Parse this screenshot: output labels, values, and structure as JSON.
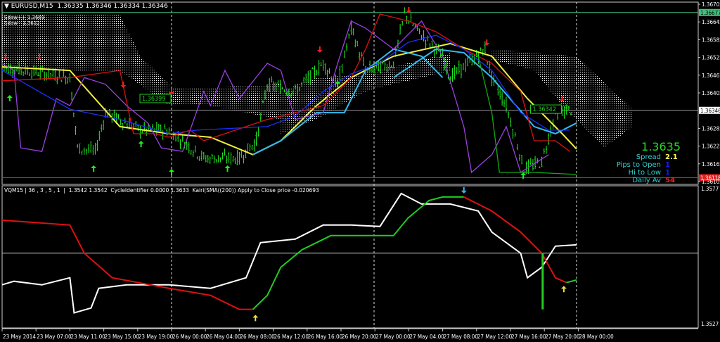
{
  "header": {
    "symbol": "EURUSD,M15",
    "ohlc": "1.36335 1.36346 1.36334 1.36346"
  },
  "indicator_header": "VQM15 | 36 , 3 , 5 , 1  |  1.3542 1.3542  CycleIdentifier 0.0000 1.3633  Kairi(SMA((200)) Apply to Close price -0.020693",
  "sdaw_labels": [
    "Sdaw++ 1.3669",
    "Sdaw-- 1.3612"
  ],
  "info_panel": {
    "price": "1.3635",
    "rows": [
      {
        "label": "Spread",
        "value": "2.1",
        "color": "#ffff55"
      },
      {
        "label": "Pips to Open",
        "value": "1",
        "color": "#1a1aff"
      },
      {
        "label": "Hi to Low",
        "value": "1",
        "color": "#1a1aff"
      },
      {
        "label": "Daily Av",
        "value": "54",
        "color": "#ee2222"
      }
    ]
  },
  "chart_data": {
    "type": "line",
    "title": "EURUSD,M15",
    "x_unit": "hours from first bar",
    "time_labels": [
      "23 May 2014",
      "23 May 07:00",
      "23 May 11:00",
      "23 May 15:00",
      "23 May 19:00",
      "26 May 00:00",
      "26 May 04:00",
      "26 May 08:00",
      "26 May 12:00",
      "26 May 16:00",
      "26 May 20:00",
      "27 May 00:00",
      "27 May 04:00",
      "27 May 08:00",
      "27 May 12:00",
      "27 May 16:00",
      "27 May 20:00",
      "28 May 00:00"
    ],
    "price_axis": {
      "range": [
        1.36105,
        1.36705
      ],
      "ticks": [
        "1.36705",
        "1.36645",
        "1.36585",
        "1.36525",
        "1.36465",
        "1.36405",
        "1.36285",
        "1.36225",
        "1.36165",
        "1.36105"
      ]
    },
    "hlines": [
      {
        "price": 1.36677,
        "label": "1.36677",
        "color": "#3ec37a"
      },
      {
        "price": 1.36346,
        "label": "1.36346",
        "color": "#9a9a9a"
      },
      {
        "price": 1.36118,
        "label": "1.36118",
        "color": "#e02020"
      }
    ],
    "price_labels": [
      {
        "x": 20.0,
        "price": 1.36386,
        "label": "1.36399"
      },
      {
        "x": 66.1,
        "price": 1.3635,
        "label": "1.36342"
      }
    ],
    "series": [
      {
        "name": "price",
        "color": "#22ee22",
        "points": [
          [
            0,
            1.36493
          ],
          [
            8.0,
            1.36457
          ],
          [
            8.9,
            1.36219
          ],
          [
            11.0,
            1.36207
          ],
          [
            12.2,
            1.36338
          ],
          [
            16.3,
            1.36279
          ],
          [
            19.7,
            1.36279
          ],
          [
            21.3,
            1.36243
          ],
          [
            23.8,
            1.36184
          ],
          [
            28.0,
            1.36184
          ],
          [
            30.0,
            1.36243
          ],
          [
            31.3,
            1.36434
          ],
          [
            34.6,
            1.3641
          ],
          [
            37.9,
            1.36505
          ],
          [
            39.6,
            1.36434
          ],
          [
            41.2,
            1.36624
          ],
          [
            42.9,
            1.36481
          ],
          [
            46.2,
            1.36505
          ],
          [
            47.5,
            1.36672
          ],
          [
            49.5,
            1.366
          ],
          [
            52.0,
            1.36529
          ],
          [
            52.9,
            1.36457
          ],
          [
            57.0,
            1.36553
          ],
          [
            57.8,
            1.36457
          ],
          [
            59.5,
            1.36362
          ],
          [
            61.6,
            1.36148
          ],
          [
            63.7,
            1.36172
          ],
          [
            65.3,
            1.36338
          ],
          [
            67.4,
            1.3635
          ]
        ]
      },
      {
        "name": "yellow-ma",
        "color": "#f0f040",
        "points": [
          [
            0,
            1.36493
          ],
          [
            8.0,
            1.36481
          ],
          [
            13.9,
            1.36291
          ],
          [
            19.7,
            1.36267
          ],
          [
            24.6,
            1.36255
          ],
          [
            29.6,
            1.36196
          ],
          [
            32.9,
            1.36243
          ],
          [
            37.1,
            1.36362
          ],
          [
            41.2,
            1.36457
          ],
          [
            46.2,
            1.36529
          ],
          [
            52.9,
            1.36572
          ],
          [
            57.8,
            1.36529
          ],
          [
            62.0,
            1.36386
          ],
          [
            66.1,
            1.36267
          ],
          [
            67.8,
            1.36215
          ]
        ]
      },
      {
        "name": "cyan-cycle-1",
        "color": "#33bbee",
        "points": [
          [
            29.6,
            1.36196
          ],
          [
            32.9,
            1.36243
          ],
          [
            37.1,
            1.36338
          ],
          [
            40.4,
            1.36338
          ],
          [
            42.9,
            1.36481
          ],
          [
            46.2,
            1.36553
          ],
          [
            49.5,
            1.36529
          ],
          [
            52.0,
            1.36457
          ]
        ]
      },
      {
        "name": "cyan-cycle-2",
        "color": "#33bbee",
        "points": [
          [
            46.2,
            1.36457
          ],
          [
            51.2,
            1.36553
          ],
          [
            54.5,
            1.36541
          ],
          [
            57.8,
            1.36457
          ],
          [
            62.8,
            1.36291
          ],
          [
            65.3,
            1.36267
          ],
          [
            67.8,
            1.36303
          ]
        ]
      },
      {
        "name": "purple",
        "color": "#9a40e0",
        "points": [
          [
            0,
            1.36505
          ],
          [
            1.4,
            1.36481
          ],
          [
            2.2,
            1.36219
          ],
          [
            4.7,
            1.36207
          ],
          [
            6.4,
            1.36386
          ],
          [
            8.0,
            1.36362
          ],
          [
            9.7,
            1.36457
          ],
          [
            12.2,
            1.36434
          ],
          [
            14.7,
            1.36362
          ],
          [
            17.2,
            1.36303
          ],
          [
            18.8,
            1.36219
          ],
          [
            21.3,
            1.36207
          ],
          [
            23.8,
            1.3641
          ],
          [
            24.6,
            1.36362
          ],
          [
            26.3,
            1.36481
          ],
          [
            28.0,
            1.36386
          ],
          [
            31.3,
            1.36505
          ],
          [
            32.9,
            1.36481
          ],
          [
            34.6,
            1.36315
          ],
          [
            37.9,
            1.36338
          ],
          [
            39.6,
            1.36505
          ],
          [
            41.2,
            1.36648
          ],
          [
            42.9,
            1.36624
          ],
          [
            46.2,
            1.36553
          ],
          [
            49.5,
            1.36648
          ],
          [
            52.0,
            1.36529
          ],
          [
            54.5,
            1.36291
          ],
          [
            55.4,
            1.36136
          ],
          [
            57.8,
            1.36196
          ],
          [
            59.5,
            1.36291
          ],
          [
            61.2,
            1.36136
          ],
          [
            64.5,
            1.36196
          ]
        ]
      },
      {
        "name": "red",
        "color": "#dd1111",
        "points": [
          [
            0,
            1.36446
          ],
          [
            8.0,
            1.36457
          ],
          [
            13.9,
            1.36481
          ],
          [
            15.5,
            1.36267
          ],
          [
            18.0,
            1.36267
          ],
          [
            19.7,
            1.36255
          ],
          [
            22.2,
            1.36279
          ],
          [
            23.8,
            1.36243
          ],
          [
            31.3,
            1.36315
          ],
          [
            34.6,
            1.36338
          ],
          [
            37.9,
            1.36362
          ],
          [
            41.2,
            1.36457
          ],
          [
            42.9,
            1.36553
          ],
          [
            44.6,
            1.36672
          ],
          [
            47.9,
            1.36648
          ],
          [
            51.2,
            1.36612
          ],
          [
            54.5,
            1.36553
          ],
          [
            57.8,
            1.36505
          ],
          [
            61.2,
            1.3641
          ],
          [
            62.8,
            1.36243
          ],
          [
            65.3,
            1.36243
          ],
          [
            67.0,
            1.36207
          ]
        ]
      },
      {
        "name": "blue",
        "color": "#1a2fff",
        "points": [
          [
            0,
            1.36481
          ],
          [
            8.0,
            1.3635
          ],
          [
            13.9,
            1.36315
          ],
          [
            19.7,
            1.36267
          ],
          [
            23.0,
            1.36279
          ],
          [
            31.3,
            1.36291
          ],
          [
            34.6,
            1.36327
          ],
          [
            37.9,
            1.3641
          ],
          [
            41.2,
            1.36469
          ],
          [
            44.6,
            1.36505
          ],
          [
            47.9,
            1.36576
          ],
          [
            51.2,
            1.366
          ],
          [
            54.5,
            1.36553
          ],
          [
            57.8,
            1.36481
          ],
          [
            61.2,
            1.36338
          ],
          [
            64.5,
            1.36279
          ],
          [
            67.0,
            1.36279
          ]
        ]
      },
      {
        "name": "dark-green",
        "color": "#11aa11",
        "points": [
          [
            56.2,
            1.36529
          ],
          [
            57.8,
            1.36338
          ],
          [
            58.7,
            1.36136
          ],
          [
            62.8,
            1.36136
          ],
          [
            67.8,
            1.36129
          ]
        ]
      }
    ],
    "clouds": [
      {
        "color": "#ffffff",
        "upper": [
          [
            0,
            1.36672
          ],
          [
            13.9,
            1.36672
          ],
          [
            16.3,
            1.36529
          ],
          [
            19.7,
            1.36434
          ]
        ],
        "lower": [
          [
            0,
            1.36493
          ],
          [
            8.0,
            1.36481
          ],
          [
            13.9,
            1.36481
          ],
          [
            19.7,
            1.36362
          ]
        ]
      },
      {
        "color": "#ffffff",
        "upper": [
          [
            19.7,
            1.36422
          ],
          [
            24.6,
            1.36422
          ],
          [
            32.9,
            1.36434
          ]
        ],
        "lower": [
          [
            19.7,
            1.36362
          ],
          [
            24.6,
            1.36362
          ],
          [
            32.9,
            1.36315
          ]
        ]
      },
      {
        "color": "#e03030",
        "upper": [
          [
            32.9,
            1.3641
          ],
          [
            37.1,
            1.36457
          ],
          [
            42.9,
            1.36469
          ]
        ],
        "lower": [
          [
            32.9,
            1.36267
          ],
          [
            37.1,
            1.36315
          ],
          [
            42.9,
            1.3641
          ]
        ]
      },
      {
        "color": "#ffffff",
        "upper": [
          [
            42.9,
            1.36481
          ],
          [
            46.2,
            1.36493
          ],
          [
            49.5,
            1.36517
          ],
          [
            52.9,
            1.36541
          ]
        ],
        "lower": [
          [
            42.9,
            1.3641
          ],
          [
            46.2,
            1.36434
          ],
          [
            49.5,
            1.36457
          ],
          [
            52.9,
            1.36481
          ]
        ]
      },
      {
        "color": "#dddddd",
        "upper": [
          [
            57.8,
            1.36553
          ],
          [
            62.8,
            1.36541
          ],
          [
            67.8,
            1.36529
          ],
          [
            74.4,
            1.3635
          ]
        ],
        "lower": [
          [
            57.8,
            1.36517
          ],
          [
            62.8,
            1.36481
          ],
          [
            66.1,
            1.36362
          ],
          [
            71.1,
            1.36219
          ],
          [
            74.4,
            1.36291
          ]
        ]
      }
    ],
    "arrows_down": [
      [
        0.4,
        1.36529
      ],
      [
        4.4,
        1.36529
      ],
      [
        14.3,
        1.36434
      ],
      [
        20.0,
        1.3641
      ],
      [
        37.5,
        1.36553
      ],
      [
        48.0,
        1.36686
      ],
      [
        57.2,
        1.36576
      ],
      [
        66.1,
        1.36386
      ]
    ],
    "arrows_up": [
      [
        0.9,
        1.36386
      ],
      [
        10.8,
        1.36148
      ],
      [
        16.4,
        1.36231
      ],
      [
        20.0,
        1.36136
      ],
      [
        26.6,
        1.36148
      ],
      [
        39.6,
        1.36434
      ],
      [
        61.5,
        1.36124
      ]
    ],
    "indicator": {
      "range": [
        1.3527,
        1.3577
      ],
      "ticks": [
        "1.3577",
        "1.3527"
      ],
      "hline": 1.35531,
      "series": [
        {
          "name": "vqm-white",
          "color": "#ffffff",
          "points": [
            [
              0,
              1.35414
            ],
            [
              1.4,
              1.35427
            ],
            [
              4.7,
              1.35414
            ],
            [
              8.0,
              1.3544
            ],
            [
              8.5,
              1.3531
            ],
            [
              10.5,
              1.35328
            ],
            [
              11.4,
              1.35401
            ],
            [
              14.7,
              1.35414
            ],
            [
              19.7,
              1.35414
            ],
            [
              24.6,
              1.35401
            ],
            [
              28.8,
              1.3544
            ],
            [
              30.5,
              1.3557
            ],
            [
              34.6,
              1.35583
            ],
            [
              37.9,
              1.35635
            ],
            [
              41.2,
              1.35635
            ],
            [
              44.6,
              1.3563
            ],
            [
              47.1,
              1.35752
            ],
            [
              49.5,
              1.35713
            ],
            [
              52.9,
              1.35713
            ],
            [
              56.2,
              1.35687
            ],
            [
              57.8,
              1.35609
            ],
            [
              61.2,
              1.35531
            ],
            [
              62.0,
              1.3544
            ],
            [
              63.7,
              1.35479
            ],
            [
              65.3,
              1.35557
            ],
            [
              67.8,
              1.35562
            ]
          ]
        },
        {
          "name": "cycle-red-1",
          "color": "#dd1111",
          "points": [
            [
              0,
              1.35653
            ],
            [
              8.0,
              1.35635
            ],
            [
              9.7,
              1.35531
            ],
            [
              13.0,
              1.3544
            ],
            [
              19.7,
              1.35401
            ],
            [
              24.6,
              1.35375
            ],
            [
              28.0,
              1.35323
            ],
            [
              29.6,
              1.35323
            ]
          ]
        },
        {
          "name": "cycle-green-1",
          "color": "#22cc22",
          "points": [
            [
              29.6,
              1.35323
            ],
            [
              31.3,
              1.35375
            ],
            [
              32.9,
              1.35479
            ],
            [
              35.4,
              1.35544
            ],
            [
              38.8,
              1.35596
            ],
            [
              46.2,
              1.35596
            ],
            [
              47.9,
              1.35661
            ],
            [
              50.4,
              1.35726
            ],
            [
              52.0,
              1.35739
            ],
            [
              54.5,
              1.35739
            ]
          ]
        },
        {
          "name": "cycle-red-2",
          "color": "#dd1111",
          "points": [
            [
              54.5,
              1.35739
            ],
            [
              57.8,
              1.35687
            ],
            [
              61.2,
              1.35609
            ],
            [
              63.7,
              1.35531
            ],
            [
              65.3,
              1.3544
            ],
            [
              66.6,
              1.35422
            ]
          ]
        },
        {
          "name": "cycle-green-2",
          "color": "#22cc22",
          "points": [
            [
              66.6,
              1.35422
            ],
            [
              67.8,
              1.35432
            ]
          ]
        },
        {
          "name": "cycle-spike",
          "color": "#22cc22",
          "points": [
            [
              63.8,
              1.35531
            ],
            [
              63.8,
              1.35323
            ]
          ]
        }
      ],
      "arrows_up": [
        [
          29.9,
          1.3529
        ],
        [
          66.3,
          1.35397
        ]
      ],
      "arrows_down": [
        [
          54.5,
          1.35765
        ]
      ]
    }
  }
}
